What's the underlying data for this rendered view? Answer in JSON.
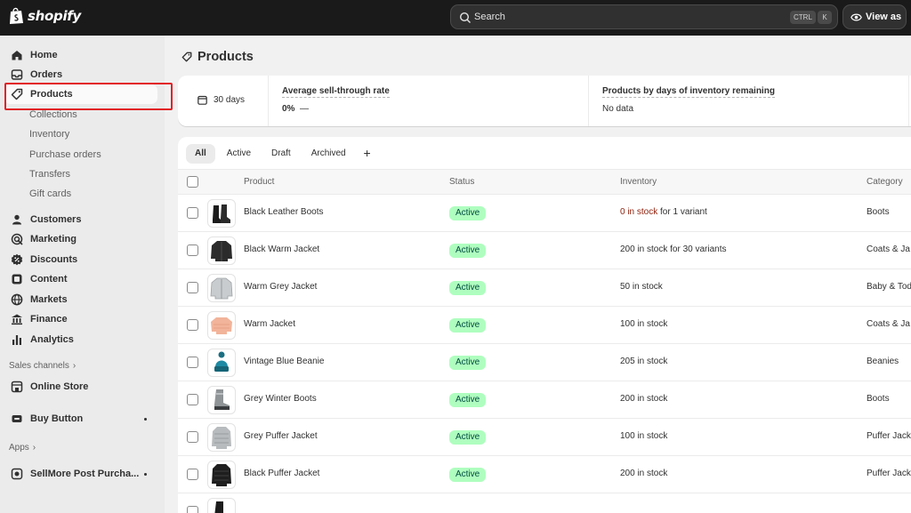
{
  "brand": {
    "name": "shopify"
  },
  "search": {
    "placeholder": "Search",
    "shortcut_ctrl": "CTRL",
    "shortcut_key": "K"
  },
  "header": {
    "view_as": "View as"
  },
  "sidebar": {
    "primary": [
      {
        "label": "Home",
        "icon": "home-icon"
      },
      {
        "label": "Orders",
        "icon": "inbox-icon"
      },
      {
        "label": "Products",
        "icon": "tag-icon",
        "selected": true
      }
    ],
    "products_sub": [
      "Collections",
      "Inventory",
      "Purchase orders",
      "Transfers",
      "Gift cards"
    ],
    "secondary": [
      {
        "label": "Customers",
        "icon": "person-icon"
      },
      {
        "label": "Marketing",
        "icon": "target-icon"
      },
      {
        "label": "Discounts",
        "icon": "discount-icon"
      },
      {
        "label": "Content",
        "icon": "content-icon"
      },
      {
        "label": "Markets",
        "icon": "globe-icon"
      },
      {
        "label": "Finance",
        "icon": "bank-icon"
      },
      {
        "label": "Analytics",
        "icon": "bar-chart-icon"
      }
    ],
    "sales_channels_label": "Sales channels",
    "online_store": "Online Store",
    "buy_button": "Buy Button",
    "apps_label": "Apps",
    "sellmore": "SellMore Post Purcha..."
  },
  "page": {
    "title": "Products"
  },
  "stats": {
    "period": "30 days",
    "sell_through_label": "Average sell-through rate",
    "sell_through_value": "0%",
    "sell_through_trend": "—",
    "days_inventory_label": "Products by days of inventory remaining",
    "days_inventory_value": "No data"
  },
  "tabs": [
    "All",
    "Active",
    "Draft",
    "Archived"
  ],
  "tab_add": "+",
  "table": {
    "headers": {
      "product": "Product",
      "status": "Status",
      "inventory": "Inventory",
      "category": "Category"
    },
    "rows": [
      {
        "product": "Black Leather Boots",
        "status": "Active",
        "inventory_count": "0 in stock",
        "inventory_suffix": " for 1 variant",
        "category": "Boots",
        "thumb": "boots-black"
      },
      {
        "product": "Black Warm Jacket",
        "status": "Active",
        "inventory": "200 in stock for 30 variants",
        "category": "Coats & Ja",
        "thumb": "jacket-black"
      },
      {
        "product": "Warm Grey Jacket",
        "status": "Active",
        "inventory": "50 in stock",
        "category": "Baby & Tod",
        "thumb": "jacket-grey"
      },
      {
        "product": "Warm Jacket",
        "status": "Active",
        "inventory": "100 in stock",
        "category": "Coats & Ja",
        "thumb": "jacket-peach"
      },
      {
        "product": "Vintage Blue Beanie",
        "status": "Active",
        "inventory": "205 in stock",
        "category": "Beanies",
        "thumb": "beanie-blue"
      },
      {
        "product": "Grey Winter Boots",
        "status": "Active",
        "inventory": "200 in stock",
        "category": "Boots",
        "thumb": "boots-grey"
      },
      {
        "product": "Grey Puffer Jacket",
        "status": "Active",
        "inventory": "100 in stock",
        "category": "Puffer Jack",
        "thumb": "puffer-grey"
      },
      {
        "product": "Black Puffer Jacket",
        "status": "Active",
        "inventory": "200 in stock",
        "category": "Puffer Jack",
        "thumb": "puffer-black"
      }
    ]
  },
  "colors": {
    "topbar": "#1a1a1a",
    "sidebar": "#ebebeb",
    "badge_bg": "#affebf",
    "badge_text": "#014b40",
    "out_of_stock": "#8e1f0b",
    "highlight": "#e21f26"
  }
}
